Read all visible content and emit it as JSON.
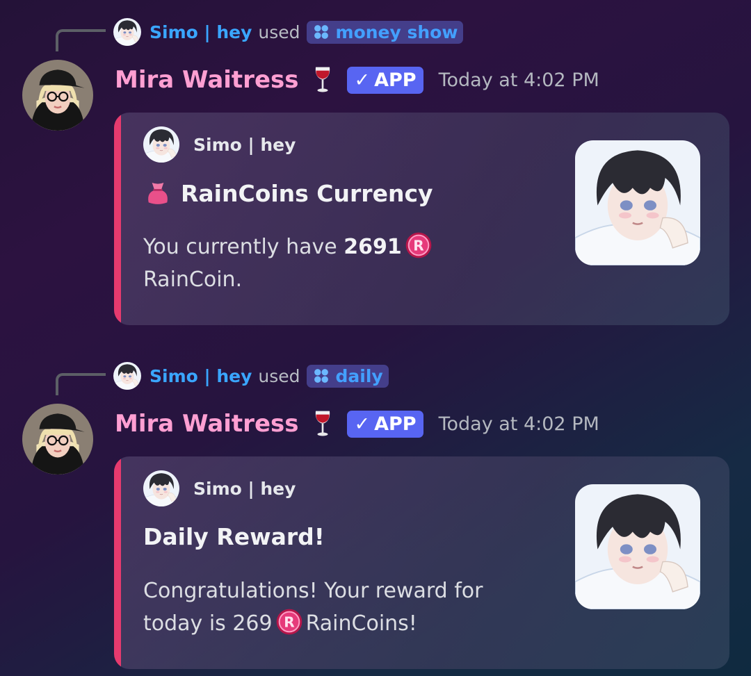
{
  "messages": [
    {
      "reply_user": "Simo | hey",
      "reply_used": "used",
      "command": "money show",
      "author": "Mira Waitress",
      "badge": "APP",
      "timestamp": "Today at 4:02 PM",
      "embed": {
        "author": "Simo | hey",
        "title": "RainCoins Currency",
        "desc_prefix": "You currently have ",
        "desc_amount": "2691",
        "desc_suffix": "RainCoin.",
        "accent_color": "#e63a6e"
      }
    },
    {
      "reply_user": "Simo | hey",
      "reply_used": "used",
      "command": "daily",
      "author": "Mira Waitress",
      "badge": "APP",
      "timestamp": "Today at 4:02 PM",
      "embed": {
        "author": "Simo | hey",
        "title": "Daily Reward!",
        "desc_prefix": "Congratulations! Your reward for today is 269",
        "desc_suffix": "RainCoins!",
        "accent_color": "#e63a6e"
      }
    }
  ],
  "icons": {
    "command": "clover-icon",
    "wine": "wine-glass-icon",
    "check": "check-icon",
    "money_bag": "money-bag-icon",
    "coin": "raincoin-icon"
  },
  "colors": {
    "author_name": "#ff9fd2",
    "reply_user": "#3aa6ff",
    "badge_bg": "#5865f2",
    "accent": "#e63a6e"
  }
}
